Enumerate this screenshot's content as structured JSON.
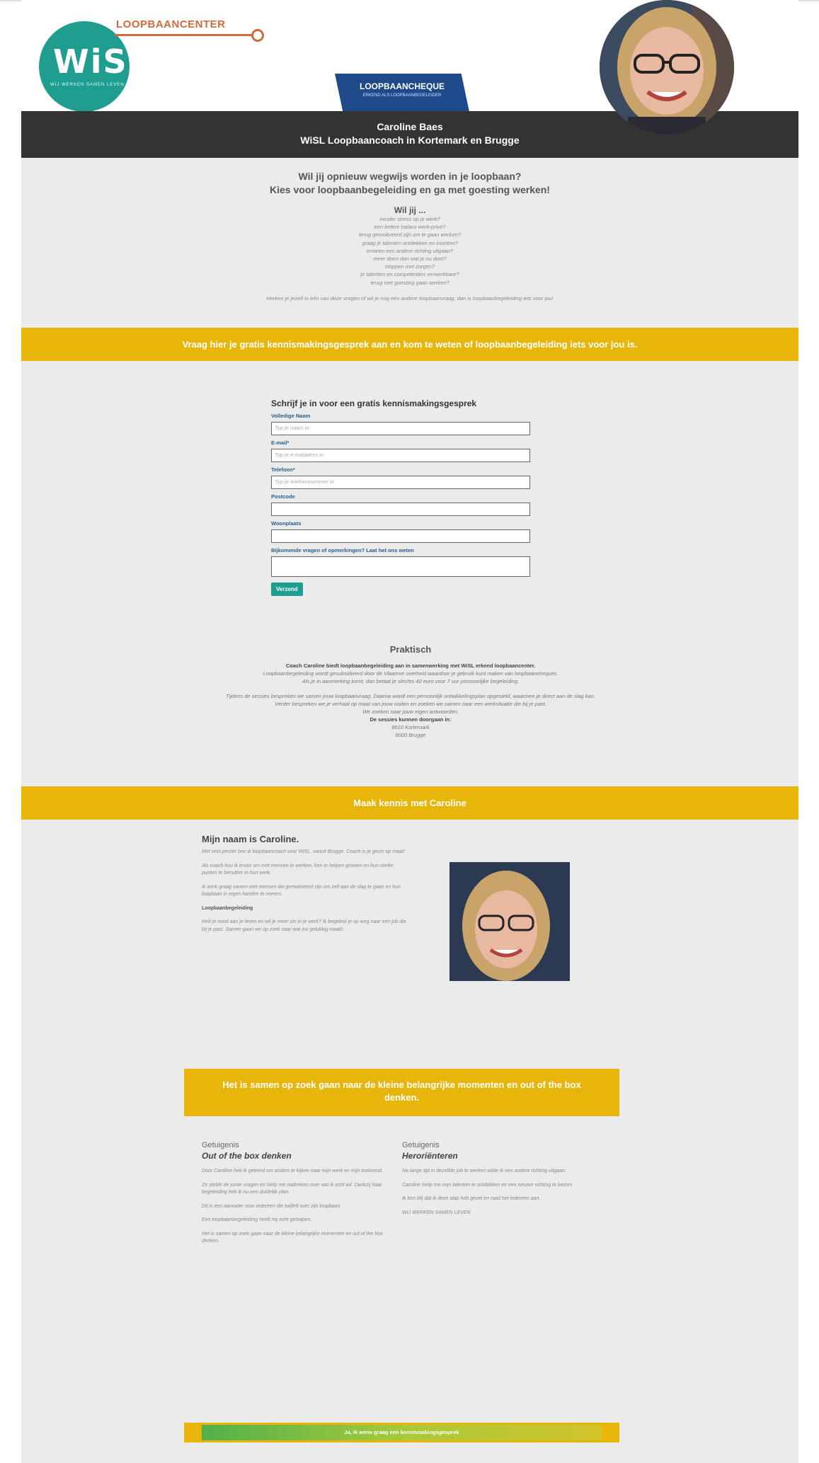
{
  "header": {
    "logo_text": "WiSL",
    "logo_tagline": "WIJ WERKEN SAMEN LEVEN",
    "loopbaancenter": "LOOPBAANCENTER",
    "cheque_title": "LOOPBAANCHEQUE",
    "cheque_sub": "ERKEND ALS LOOPBAANBEGELEIDER",
    "name_line": "Caroline Baes",
    "role_line": "WiSL Loopbaancoach in Kortemark en Brugge"
  },
  "intro": {
    "headline1": "Wil jij opnieuw wegwijs worden in je loopbaan?",
    "headline2": "Kies voor loopbaanbegeleiding en ga met goesting werken!",
    "wil_jij": "Wil jij ...",
    "questions": [
      "minder stress op je werk?",
      "een betere balans werk-privé?",
      "terug gemotiveerd zijn om te gaan werken?",
      "graag je talenten ontdekken en inzetten?",
      "ervaren een andere richting uitgaan?",
      "meer doen dan wat je nu doet?",
      "stoppen met zorgen?",
      "je talenten en competenties verwerkbare?",
      "terug met goesting gaan werken?"
    ],
    "note": "Herken je jezelf in één van deze vragen of wil je nog een andere loopbaanvraag, dan is loopbaanbegeleiding iets voor jou!"
  },
  "band1": "Vraag hier je gratis kennismakingsgesprek aan en kom te weten of loopbaanbegeleiding iets voor jou is.",
  "form": {
    "title": "Schrijf je in voor een gratis kennismakingsgesprek",
    "name_label": "Volledige Naam",
    "name_placeholder": "Typ je naam in",
    "email_label": "E-mail*",
    "email_placeholder": "Typ je e-mailadres in",
    "phone_label": "Telefoon*",
    "phone_placeholder": "Typ je telefoonnummer in",
    "postcode_label": "Postcode",
    "city_label": "Woonplaats",
    "remarks_label": "Bijkomende vragen of opmerkingen? Laat het ons weten",
    "submit": "Verzend"
  },
  "praktisch": {
    "title": "Praktisch",
    "bold1": "Coach Caroline biedt loopbaanbegeleiding aan in samenwerking met WiSL erkend loopbaancenter.",
    "p1": "Loopbaanbegeleiding wordt gesubsidieerd door de Vlaamse overheid waardoor je gebruik kunt maken van loopbaancheques.",
    "p2": "Als je in aanmerking komt, dan betaal je slechts 40 euro voor 7 uur persoonlijke begeleiding.",
    "p3": "Tijdens de sessies bespreken we samen jouw loopbaanvraag. Daarna wordt een persoonlijk ontwikkelingsplan opgesteld, waarmee je direct aan de slag kan.",
    "p4": "Verder bespreken we je verhaal op maat van jouw noden en zoeken we samen naar een werksituatie die bij je past.",
    "p5": "We zoeken naar jouw eigen antwoorden.",
    "address_title": "De sessies kunnen doorgaan in:",
    "address1": "8610 Kortemark",
    "address2": "8000 Brugge"
  },
  "band2": "Maak kennis met Caroline",
  "about": {
    "title": "Mijn naam is Caroline.",
    "p1": "Met veel plezier ben ik loopbaancoach voor WiSL, vanuit Brugge. Coach is je gezin op maat!",
    "p2": "Als coach hou ik ervan om met mensen te werken, hen te helpen groeien en hun sterke punten te benutten in hun werk.",
    "p3": "Ik werk graag samen met mensen die gemotiveerd zijn om zelf aan de slag te gaan en hun loopbaan in eigen handen te nemen.",
    "subtitle": "Loopbaanbegeleiding",
    "p4": "Heb je nood aan je leven en wil je meer zin in je werk? Ik begeleid je op weg naar een job die bij je past. Samen gaan we op zoek naar wat jou gelukkig maakt."
  },
  "quote": "Het is samen op zoek gaan naar de kleine belangrijke momenten en out of the box denken.",
  "testimonials": [
    {
      "label": "Getuigenis",
      "title": "Out of the box denken",
      "paragraphs": [
        "Door Caroline heb ik geleerd om anders te kijken naar mijn werk en mijn toekomst.",
        "Ze stelde de juiste vragen en hielp me nadenken over wat ik echt wil. Dankzij haar begeleiding heb ik nu een duidelijk plan.",
        "Dit is een aanrader voor iedereen die twijfelt over zijn loopbaan.",
        "Een loopbaanbegeleiding heeft mij echt geholpen.",
        "Het is samen op zoek gaan naar de kleine belangrijke momenten en out of the box denken."
      ]
    },
    {
      "label": "Getuigenis",
      "title": "Heroriënteren",
      "paragraphs": [
        "Na lange tijd in dezelfde job te werken wilde ik een andere richting uitgaan.",
        "Caroline hielp me mijn talenten te ontdekken en een nieuwe richting te kiezen.",
        "Ik ben blij dat ik deze stap heb gezet en raad het iedereen aan.",
        "WIJ WERKEN SAMEN LEVEN"
      ]
    }
  ],
  "cta": "Ja, ik wens graag een kennismakingsgesprek"
}
